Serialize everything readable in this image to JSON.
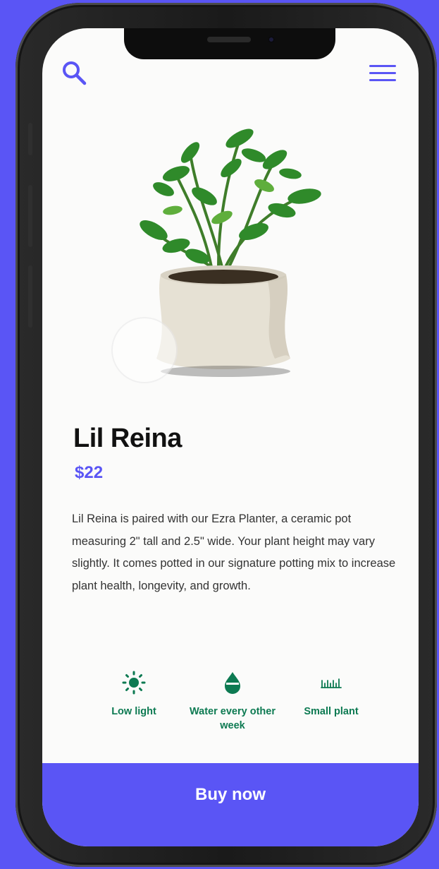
{
  "header": {
    "search_icon": "search-icon",
    "menu_icon": "hamburger-menu-icon"
  },
  "product": {
    "name": "Lil Reina",
    "price": "$22",
    "description": "Lil Reina is paired with our Ezra Planter, a ceramic pot measuring 2\" tall and 2.5\" wide. Your plant height may vary slightly. It comes potted in our signature potting mix to increase plant health, longevity, and growth."
  },
  "features": [
    {
      "icon": "sun-icon",
      "label": "Low light"
    },
    {
      "icon": "water-drop-icon",
      "label": "Water every other week"
    },
    {
      "icon": "plant-size-icon",
      "label": "Small plant"
    }
  ],
  "cta": {
    "label": "Buy now"
  },
  "colors": {
    "accent": "#5a55f5",
    "feature_green": "#0d7a52",
    "background": "#fbfbfa"
  }
}
